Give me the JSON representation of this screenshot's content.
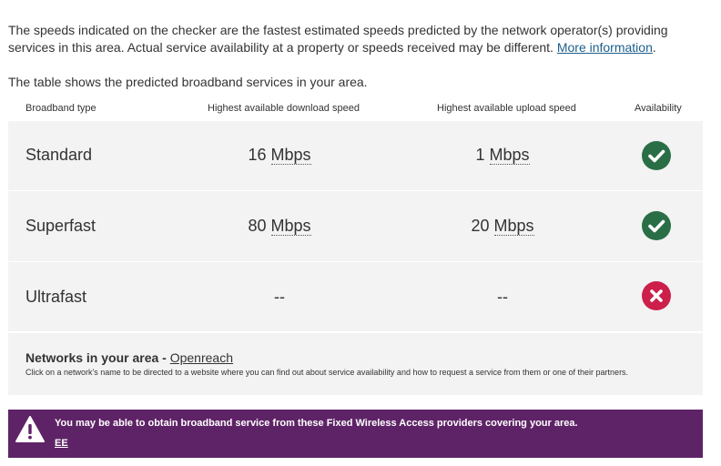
{
  "intro": {
    "text": "The speeds indicated on the checker are the fastest estimated speeds predicted by the network operator(s) providing services in this area. Actual service availability at a property or speeds received may be different.",
    "link_label": "More information",
    "trailing": "."
  },
  "table_intro": "The table shows the predicted broadband services in your area.",
  "table": {
    "headers": {
      "type": "Broadband type",
      "download": "Highest available download speed",
      "upload": "Highest available upload speed",
      "availability": "Availability"
    },
    "rows": [
      {
        "type": "Standard",
        "download_value": "16",
        "download_unit": "Mbps",
        "upload_value": "1",
        "upload_unit": "Mbps",
        "available": true,
        "icon": "check-circle-icon"
      },
      {
        "type": "Superfast",
        "download_value": "80",
        "download_unit": "Mbps",
        "upload_value": "20",
        "upload_unit": "Mbps",
        "available": true,
        "icon": "check-circle-icon"
      },
      {
        "type": "Ultrafast",
        "download_value": "--",
        "download_unit": "",
        "upload_value": "--",
        "upload_unit": "",
        "available": false,
        "icon": "cross-circle-icon"
      }
    ]
  },
  "networks": {
    "label": "Networks in your area - ",
    "provider": "Openreach",
    "note": "Click on a network's name to be directed to a website where you can find out about service availability and how to request a service from them or one of their partners."
  },
  "fwa": {
    "icon": "warning-triangle-icon",
    "message": "You may be able to obtain broadband service from these Fixed Wireless Access providers covering your area.",
    "provider": "EE"
  },
  "colors": {
    "available": "#2a6e46",
    "unavailable": "#cc1f4a",
    "banner": "#5e2366",
    "row_bg": "#f3f3f3",
    "link": "#1d5e8c"
  }
}
